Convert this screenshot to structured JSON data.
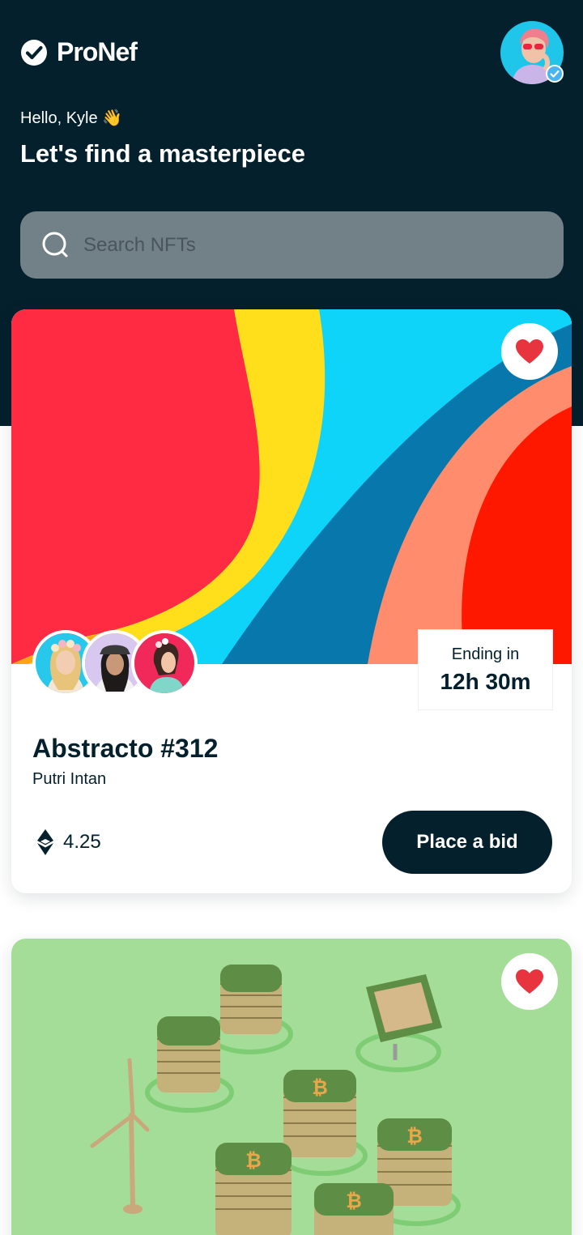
{
  "app": {
    "name": "ProNef",
    "icons": {
      "logo": "check-circle-icon",
      "profile_badge": "verified-badge-icon"
    }
  },
  "header": {
    "greeting": "Hello, Kyle 👋",
    "headline": "Let's find a masterpiece"
  },
  "search": {
    "placeholder": "Search NFTs",
    "icon": "search-icon"
  },
  "colors": {
    "primary": "#03202c",
    "search_bg": "#728188",
    "like": "#e8343f",
    "card2_bg": "#a4dd98"
  },
  "cards": [
    {
      "title": "Abstracto #312",
      "author": "Putri Intan",
      "ending_label": "Ending in",
      "ending_time": "12h 30m",
      "price": "4.25",
      "price_icon": "ethereum-icon",
      "bid_label": "Place a bid",
      "liked": true
    },
    {
      "liked": true
    }
  ]
}
